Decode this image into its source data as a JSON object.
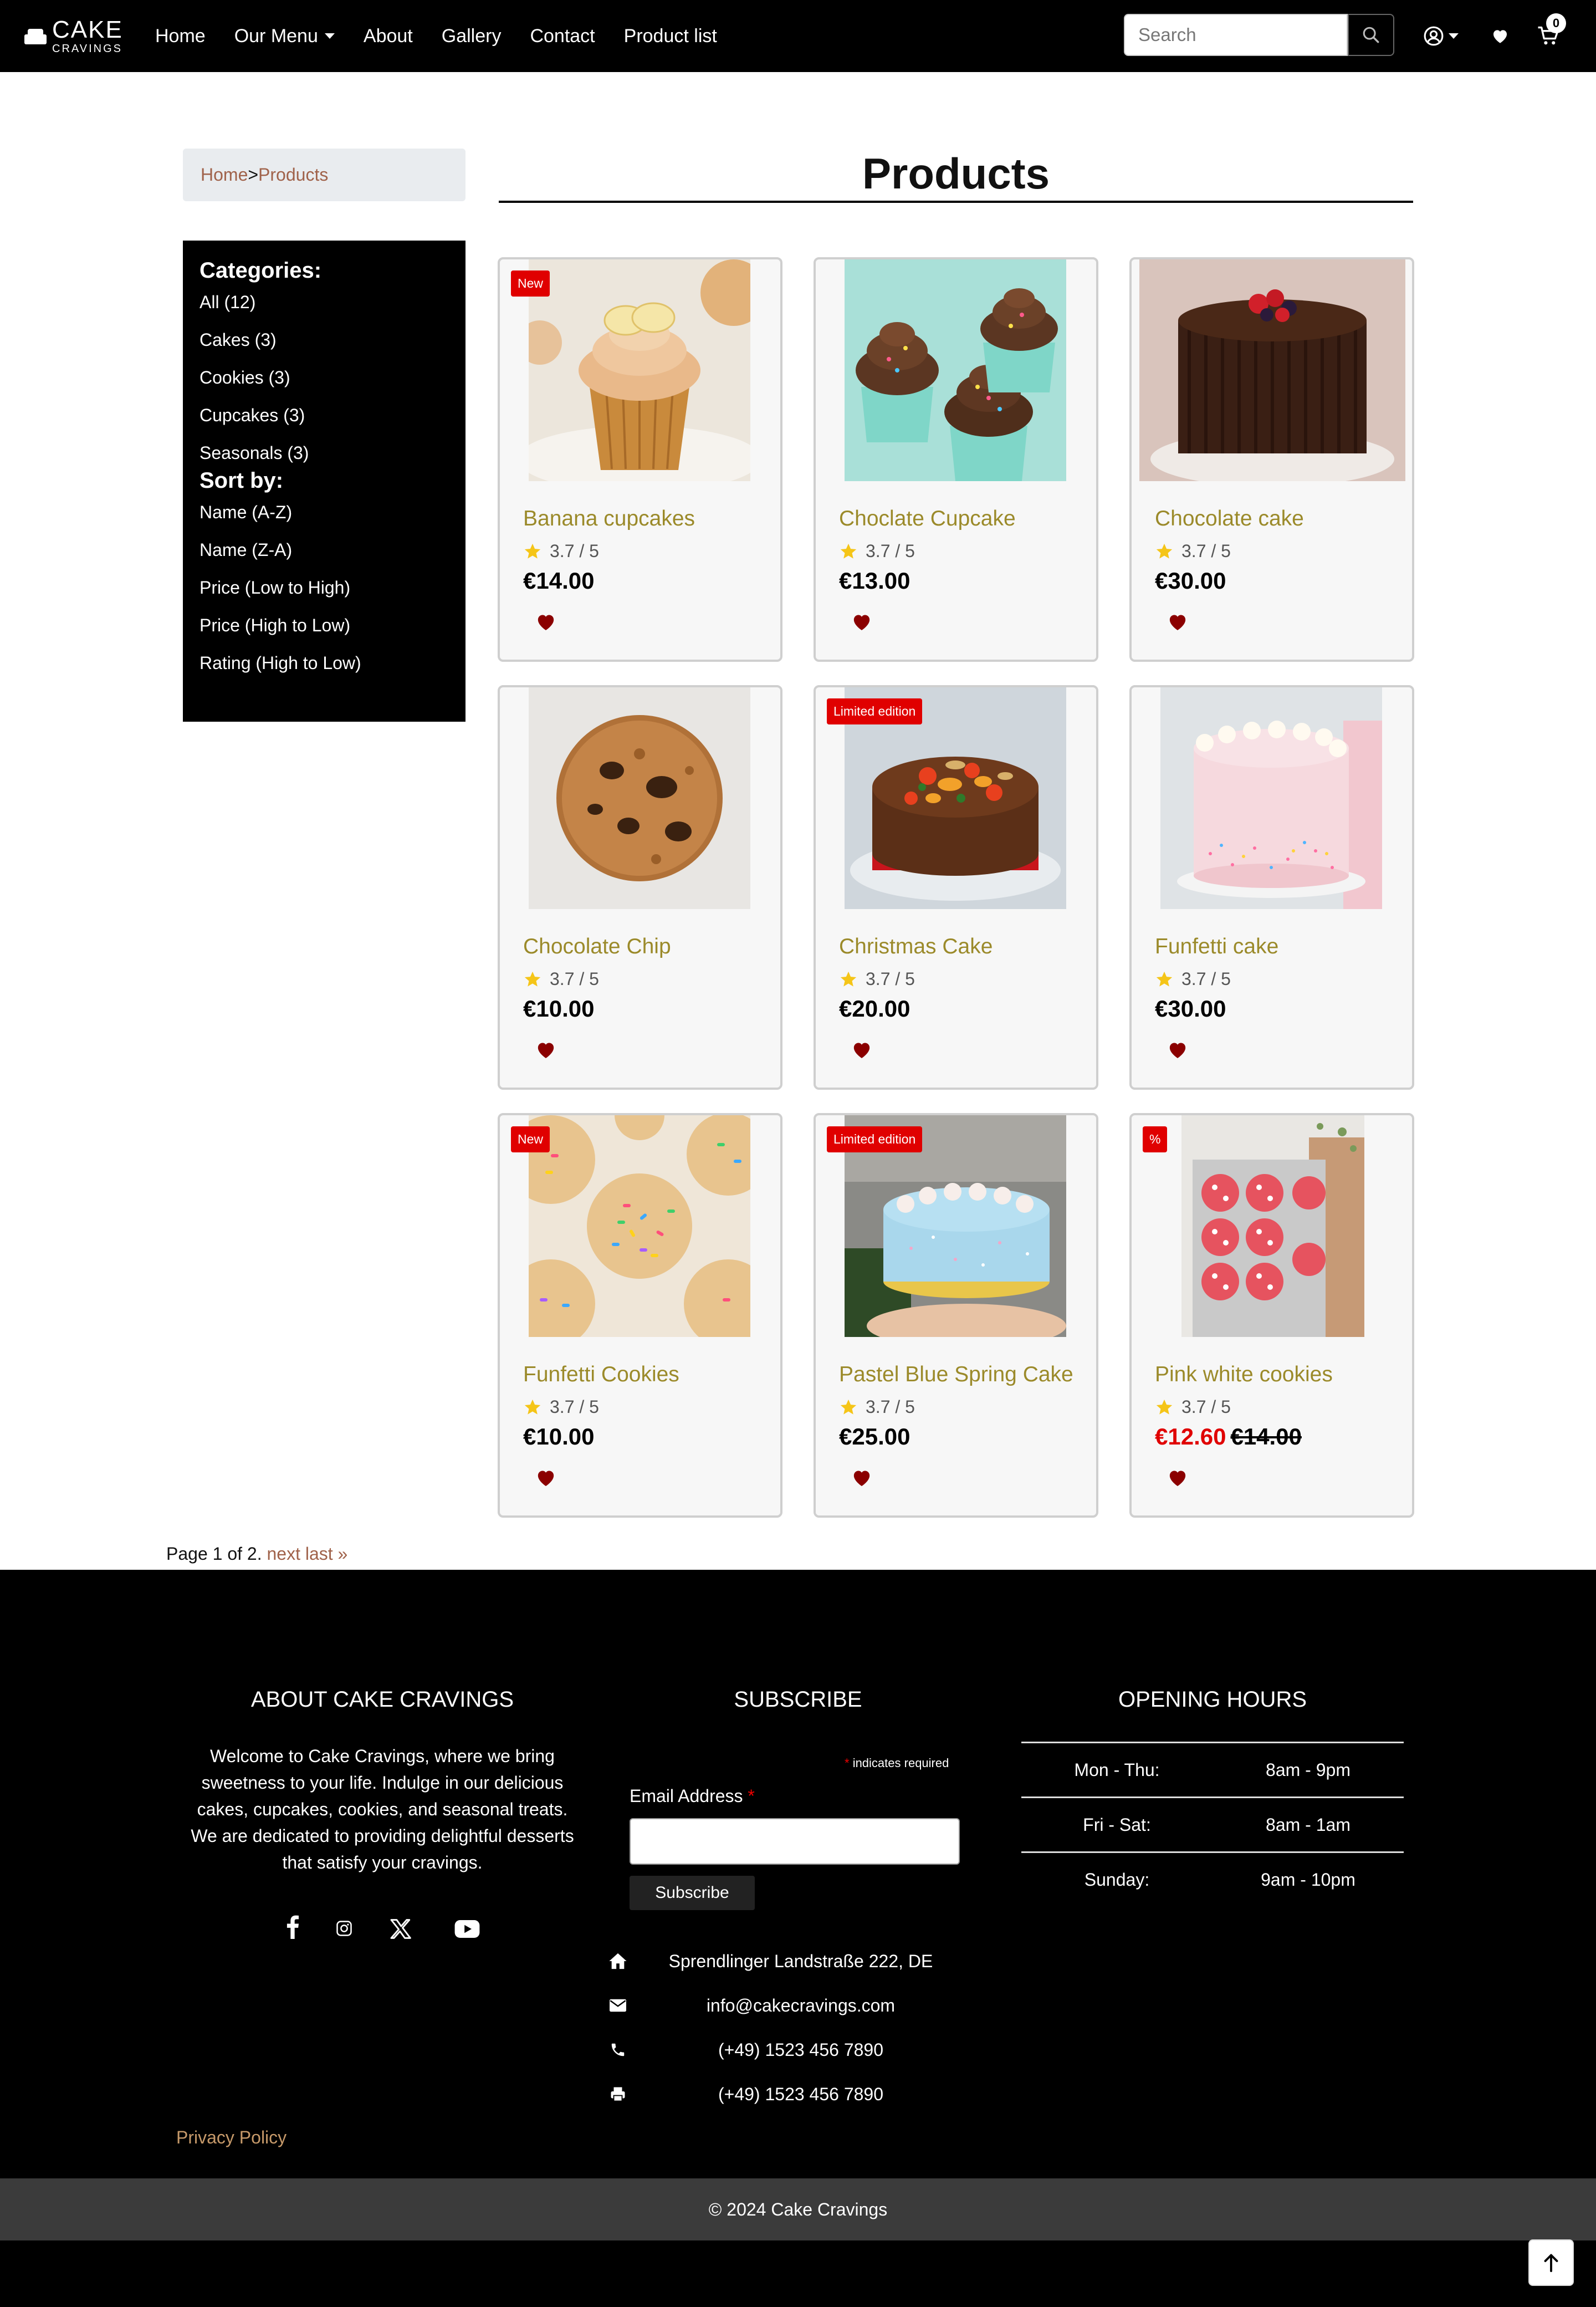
{
  "nav": {
    "brand_top": "CAKE",
    "brand_bottom": "CRAVINGS",
    "links": [
      "Home",
      "Our Menu",
      "About",
      "Gallery",
      "Contact",
      "Product list"
    ],
    "search_placeholder": "Search",
    "cart_count": "0"
  },
  "breadcrumb": {
    "home": "Home",
    "separator": ">",
    "current": "Products"
  },
  "page_title": "Products",
  "sidebar": {
    "categories_title": "Categories:",
    "categories": [
      "All (12)",
      "Cakes (3)",
      "Cookies (3)",
      "Cupcakes (3)",
      "Seasonals (3)"
    ],
    "sort_title": "Sort by:",
    "sort_options": [
      "Name (A-Z)",
      "Name (Z-A)",
      "Price (Low to High)",
      "Price (High to Low)",
      "Rating (High to Low)"
    ]
  },
  "products": [
    {
      "name": "Banana cupcakes",
      "rating": "3.7 / 5",
      "price": "€14.00",
      "badge": "New"
    },
    {
      "name": "Choclate Cupcake",
      "rating": "3.7 / 5",
      "price": "€13.00",
      "badge": ""
    },
    {
      "name": "Chocolate cake",
      "rating": "3.7 / 5",
      "price": "€30.00",
      "badge": ""
    },
    {
      "name": "Chocolate Chip",
      "rating": "3.7 / 5",
      "price": "€10.00",
      "badge": ""
    },
    {
      "name": "Christmas Cake",
      "rating": "3.7 / 5",
      "price": "€20.00",
      "badge": "Limited edition"
    },
    {
      "name": "Funfetti cake",
      "rating": "3.7 / 5",
      "price": "€30.00",
      "badge": ""
    },
    {
      "name": "Funfetti Cookies",
      "rating": "3.7 / 5",
      "price": "€10.00",
      "badge": "New"
    },
    {
      "name": "Pastel Blue Spring Cake",
      "rating": "3.7 / 5",
      "price": "€25.00",
      "badge": "Limited edition"
    },
    {
      "name": "Pink white cookies",
      "rating": "3.7 / 5",
      "price": "€12.60",
      "original_price": "€14.00",
      "badge": "%"
    }
  ],
  "pagination": {
    "text": "Page 1 of 2.",
    "next": "next",
    "last": "last »"
  },
  "footer": {
    "about_title": "ABOUT CAKE CRAVINGS",
    "about_text": "Welcome to Cake Cravings, where we bring sweetness to your life. Indulge in our delicious cakes, cupcakes, cookies, and seasonal treats. We are dedicated to providing delightful desserts that satisfy your cravings.",
    "subscribe_title": "SUBSCRIBE",
    "required_note": "indicates required",
    "email_label": "Email Address",
    "subscribe_button": "Subscribe",
    "address": "Sprendlinger Landstraße 222, DE",
    "email": "info@cakecravings.com",
    "phone": "(+49) 1523 456 7890",
    "fax": "(+49) 1523 456 7890",
    "hours_title": "OPENING HOURS",
    "hours": [
      {
        "day": "Mon - Thu:",
        "time": "8am - 9pm"
      },
      {
        "day": "Fri - Sat:",
        "time": "8am - 1am"
      },
      {
        "day": "Sunday:",
        "time": "9am - 10pm"
      }
    ],
    "privacy": "Privacy Policy",
    "copyright": "© 2024 Cake Cravings"
  },
  "colors": {
    "accent_link": "#a0624a",
    "product_name": "#9b8a2a",
    "badge": "#e00000",
    "heart": "#8b0000",
    "star": "#f5c518"
  },
  "icons": [
    "search-icon",
    "user-icon",
    "heart-icon",
    "cart-icon",
    "star-icon",
    "facebook-icon",
    "instagram-icon",
    "x-icon",
    "youtube-icon",
    "home-icon",
    "envelope-icon",
    "phone-icon",
    "printer-icon",
    "arrow-up-icon"
  ]
}
